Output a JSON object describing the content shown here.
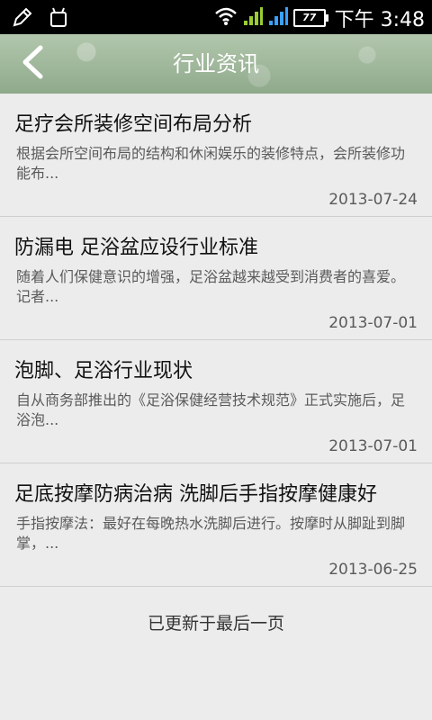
{
  "status_bar": {
    "time": "下午 3:48",
    "battery": "77",
    "icons": [
      "pen-icon",
      "android-icon",
      "wifi-icon",
      "signal-icon",
      "signal-icon",
      "battery-icon"
    ]
  },
  "header": {
    "title": "行业资讯",
    "back_icon": "chevron-left-icon"
  },
  "articles": [
    {
      "title": "足疗会所装修空间布局分析",
      "summary": "根据会所空间布局的结构和休闲娱乐的装修特点，会所装修功能布...",
      "date": "2013-07-24"
    },
    {
      "title": "防漏电 足浴盆应设行业标准",
      "summary": "随着人们保健意识的增强，足浴盆越来越受到消费者的喜爱。记者...",
      "date": "2013-07-01"
    },
    {
      "title": "泡脚、足浴行业现状",
      "summary": "自从商务部推出的《足浴保健经营技术规范》正式实施后，足浴泡...",
      "date": "2013-07-01"
    },
    {
      "title": "足底按摩防病治病 洗脚后手指按摩健康好",
      "summary": "手指按摩法：最好在每晚热水洗脚后进行。按摩时从脚趾到脚掌，...",
      "date": "2013-06-25"
    }
  ],
  "footer": {
    "message": "已更新于最后一页"
  }
}
